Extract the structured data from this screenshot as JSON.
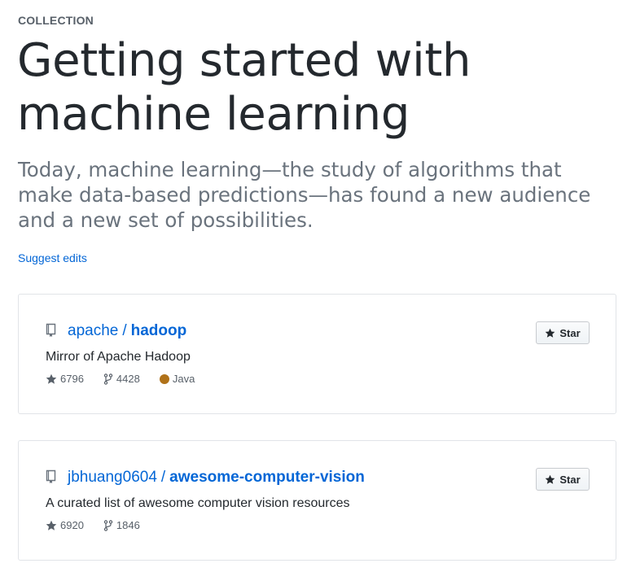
{
  "collection": {
    "eyebrow": "COLLECTION",
    "title": "Getting started with machine learning",
    "description": "Today, machine learning—the study of algorithms that make data-based predictions—has found a new audience and a new set of possibilities.",
    "suggest_edits": "Suggest edits"
  },
  "repos": [
    {
      "owner": "apache",
      "separator": "/",
      "name": "hadoop",
      "description": "Mirror of Apache Hadoop",
      "stars": "6796",
      "forks": "4428",
      "language": "Java",
      "language_color": "#b07219",
      "star_button": "Star"
    },
    {
      "owner": "jbhuang0604",
      "separator": "/",
      "name": "awesome-computer-vision",
      "description": "A curated list of awesome computer vision resources",
      "stars": "6920",
      "forks": "1846",
      "star_button": "Star"
    }
  ],
  "colors": {
    "link": "#0366d6",
    "text": "#24292e",
    "muted": "#586069",
    "lead": "#6a737d",
    "border": "#e1e4e8"
  },
  "icons": [
    "repo-icon",
    "star-icon",
    "fork-icon"
  ]
}
